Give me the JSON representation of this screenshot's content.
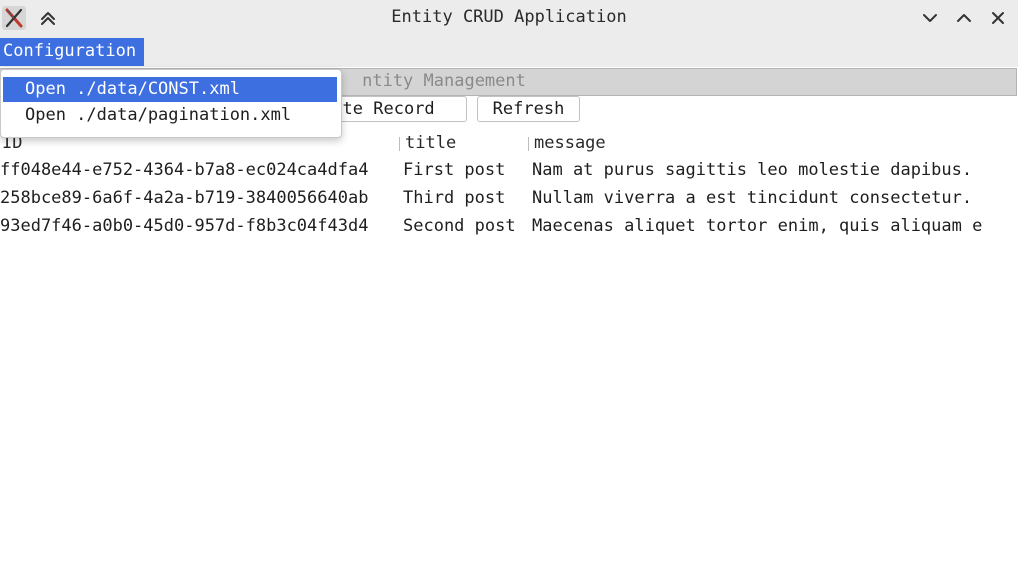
{
  "window": {
    "title": "Entity CRUD Application",
    "icons": {
      "app": "x-app-icon",
      "keep_above": "double-chevron-up-icon",
      "minimize": "chevron-down-icon",
      "maximize": "chevron-up-icon",
      "close": "close-icon"
    }
  },
  "menubar": {
    "configuration": "Configuration",
    "dropdown": [
      {
        "label": "Open ./data/CONST.xml",
        "active": true
      },
      {
        "label": "Open ./data/pagination.xml",
        "active": false
      }
    ]
  },
  "frame": {
    "title": "ntity Management"
  },
  "toolbar": {
    "delete_label": "ete Record",
    "refresh_label": "Refresh"
  },
  "table": {
    "columns": [
      "ID",
      "title",
      "message"
    ],
    "rows": [
      [
        "ff048e44-e752-4364-b7a8-ec024ca4dfa4",
        "First post",
        "Nam at purus sagittis leo molestie dapibus."
      ],
      [
        "258bce89-6a6f-4a2a-b719-3840056640ab",
        "Third post",
        "Nullam viverra a est tincidunt consectetur."
      ],
      [
        "93ed7f46-a0b0-45d0-957d-f8b3c04f43d4",
        "Second post",
        "Maecenas aliquet tortor enim, quis aliquam e"
      ]
    ]
  },
  "colors": {
    "accent": "#3d6fe0",
    "titlebar_bg": "#ececec",
    "frame_header_bg": "#d4d4d4"
  }
}
